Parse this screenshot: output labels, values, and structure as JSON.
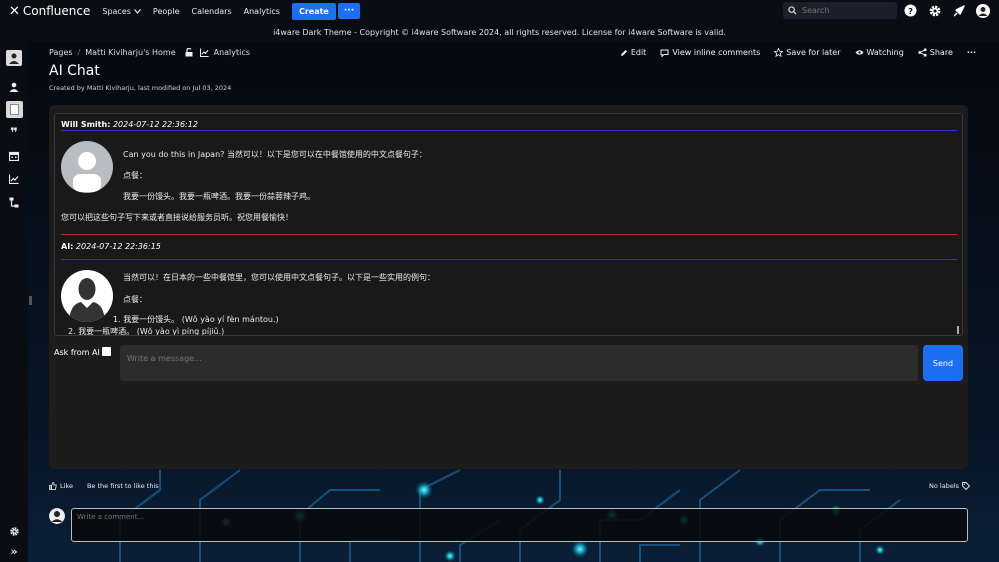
{
  "colors": {
    "accent": "#1d6ff2",
    "user_rule": "#2b2dd8",
    "ai_rule": "#c42626",
    "panel_bg": "#1c1c1c",
    "page_bg": "#06080e"
  },
  "topnav": {
    "logo_label": "Confluence",
    "items": [
      {
        "label": "Spaces",
        "has_chevron": true
      },
      {
        "label": "People"
      },
      {
        "label": "Calendars"
      },
      {
        "label": "Analytics"
      }
    ],
    "create_label": "Create",
    "more_label": "···",
    "search_placeholder": "Search",
    "icons": [
      "help-icon",
      "gear-icon",
      "notification-icon",
      "user-avatar-icon"
    ]
  },
  "banner": {
    "text": "i4ware Dark Theme - Copyright © i4ware Software 2024, all rights reserved. License for i4ware Software is valid."
  },
  "sidebar": {
    "icons": [
      "space-avatar-icon",
      "people-icon",
      "page-icon",
      "quote-icon",
      "calendar-icon",
      "analytics-icon",
      "hierarchy-icon"
    ],
    "bottom_icons": [
      "settings-icon",
      "expand-icon"
    ]
  },
  "breadcrumb": {
    "items": [
      "Pages",
      "Matti Kiviharju's Home",
      "Analytics"
    ]
  },
  "page": {
    "title": "AI Chat",
    "byline": "Created by Matti Kiviharju, last modified on Jul 03, 2024"
  },
  "actions": {
    "edit": "Edit",
    "view_comments": "View inline comments",
    "save_later": "Save for later",
    "watching": "Watching",
    "share": "Share",
    "more": "···"
  },
  "chat": {
    "messages": [
      {
        "author": "Will Smith:",
        "timestamp": "2024-07-12 22:36:12",
        "line1": "Can you do this in Japan? 当然可以！以下是您可以在中餐馆使用的中文点餐句子：",
        "line2": "点餐：",
        "line3": "我要一份馒头。我要一瓶啤酒。我要一份蒜蓉辣子鸡。",
        "line4": "您可以把这些句子写下来或者直接说给服务员听。祝您用餐愉快！"
      },
      {
        "author": "AI:",
        "timestamp": "2024-07-12 22:36:15",
        "line1": "当然可以！在日本的一些中餐馆里，您可以使用中文点餐句子。以下是一些实用的例句：",
        "line2": "点餐：",
        "list1": "我要一份馒头。 (Wǒ yào yí fèn mántou.)",
        "list2": "我要一瓶啤酒。 (Wǒ yào yì píng píjiǔ.)"
      }
    ],
    "ask_label": "Ask from AI",
    "ask_checked": false,
    "input_placeholder": "Write a message...",
    "send_label": "Send"
  },
  "footer": {
    "like_label": "Like",
    "first_like": "Be the first to like this",
    "labels_label": "No labels",
    "comment_placeholder": "Write a comment..."
  }
}
